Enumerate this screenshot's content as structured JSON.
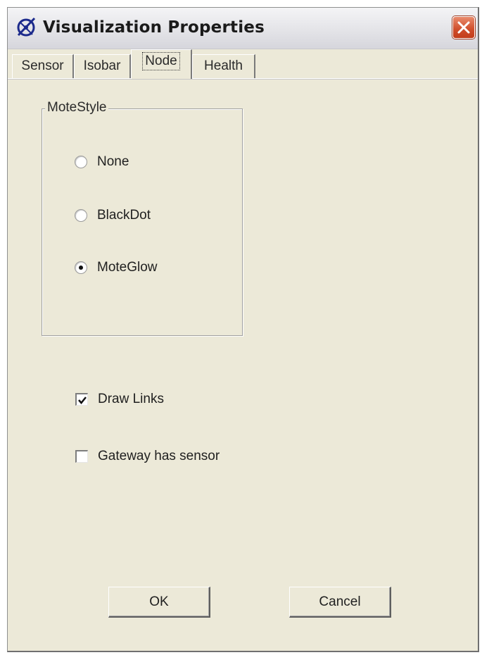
{
  "window": {
    "title": "Visualization Properties",
    "app_icon": "radar-app-icon",
    "close_icon": "close-icon"
  },
  "tabs": [
    {
      "label": "Sensor",
      "active": false
    },
    {
      "label": "Isobar",
      "active": false
    },
    {
      "label": "Node",
      "active": true
    },
    {
      "label": "Health",
      "active": false
    }
  ],
  "mote_style": {
    "legend": "MoteStyle",
    "options": [
      {
        "label": "None",
        "checked": false
      },
      {
        "label": "BlackDot",
        "checked": false
      },
      {
        "label": "MoteGlow",
        "checked": true
      }
    ]
  },
  "checkboxes": [
    {
      "label": "Draw Links",
      "checked": true
    },
    {
      "label": "Gateway has sensor",
      "checked": false
    }
  ],
  "buttons": {
    "ok_label": "OK",
    "cancel_label": "Cancel"
  },
  "colors": {
    "dialog_bg": "#ece9d8",
    "close_button": "#cf4d2a",
    "app_icon": "#1c2a8c"
  }
}
